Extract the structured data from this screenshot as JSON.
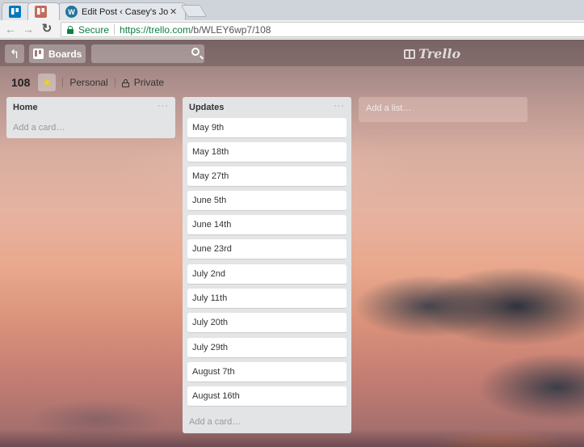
{
  "browser": {
    "tabs": [
      {
        "title": "",
        "icon": "trello-icon"
      },
      {
        "title": "",
        "icon": "trello-icon"
      },
      {
        "title": "Edit Post ‹ Casey's Journ",
        "icon": "wordpress-icon",
        "close": "✕"
      }
    ],
    "secure_label": "Secure",
    "url_main": "https://trello.com",
    "url_rest": "/b/WLEY6wp7/108"
  },
  "header": {
    "boards_label": "Boards",
    "logo_text": "Trello"
  },
  "board": {
    "name": "108",
    "team": "Personal",
    "visibility": "Private"
  },
  "lists": [
    {
      "title": "Home",
      "menu": "···",
      "cards": [],
      "add_card": "Add a card…"
    },
    {
      "title": "Updates",
      "menu": "···",
      "cards": [
        "May 9th",
        "May 18th",
        "May 27th",
        "June 5th",
        "June 14th",
        "June 23rd",
        "July 2nd",
        "July 11th",
        "July 20th",
        "July 29th",
        "August 7th",
        "August 16th"
      ],
      "add_card": "Add a card…"
    }
  ],
  "add_list": "Add a list…",
  "colors": {
    "trello_blue": "#0079bf",
    "wordpress_blue": "#21759b",
    "star_yellow": "#f2d600",
    "secure_green": "#0b8043"
  }
}
